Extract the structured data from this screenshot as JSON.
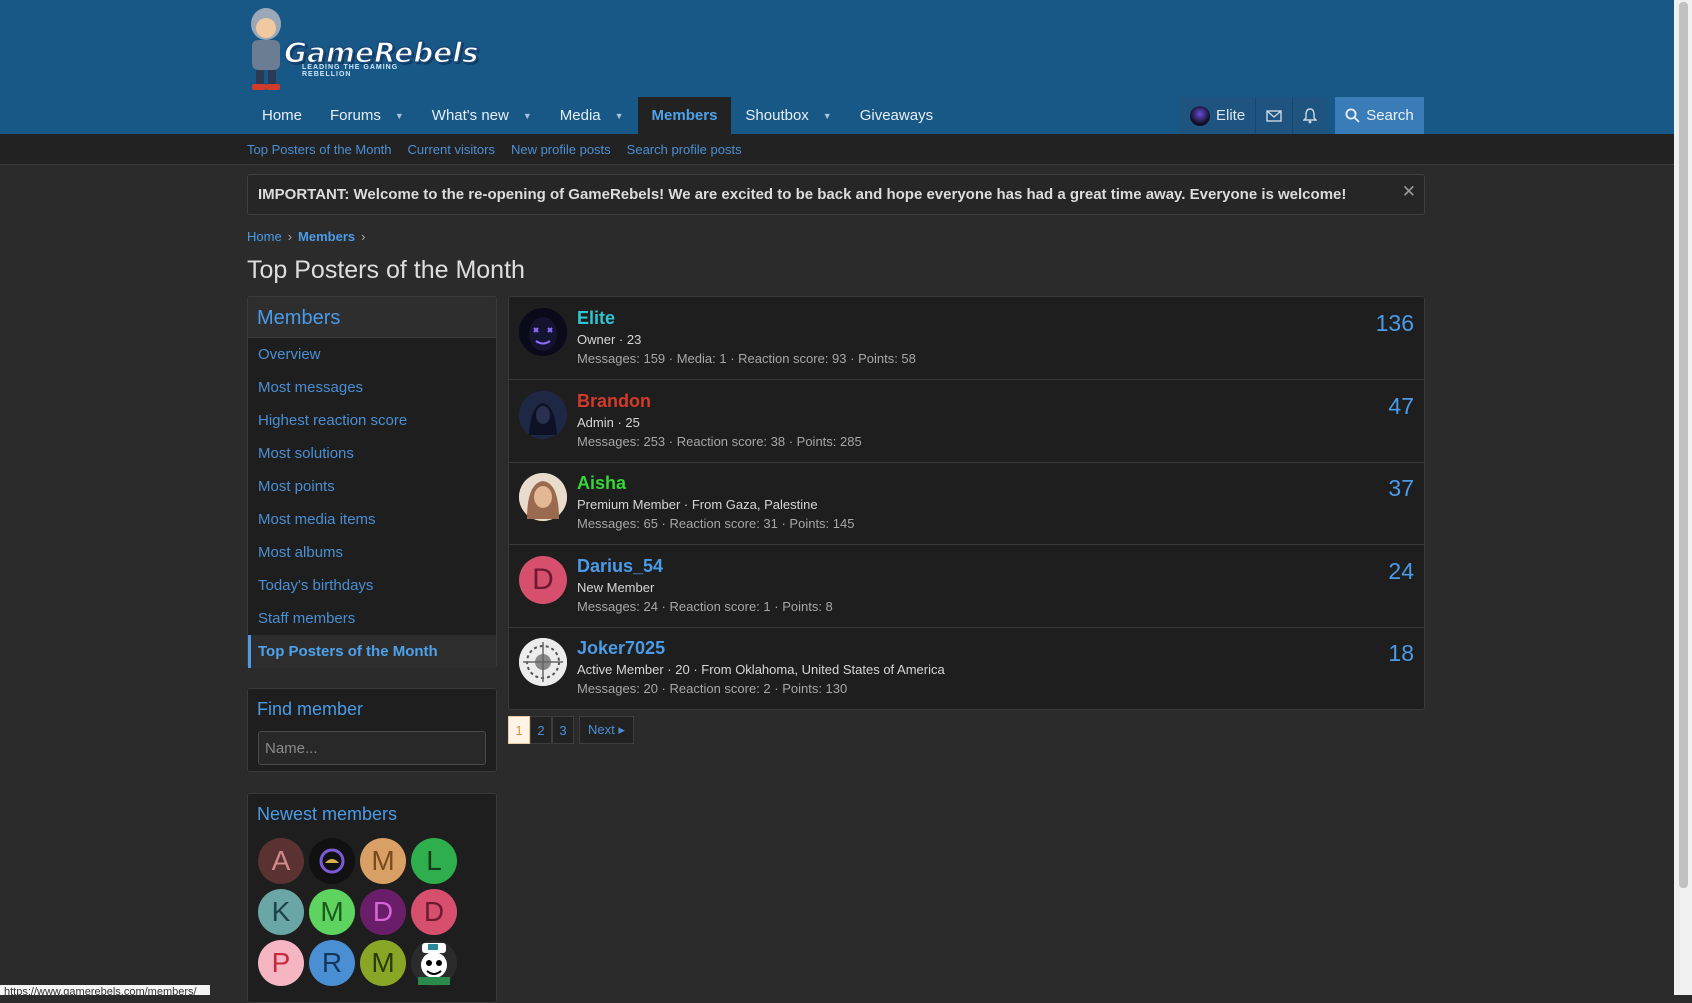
{
  "brand": {
    "name": "GameRebels",
    "tagline": "LEADING THE GAMING REBELLION"
  },
  "nav": {
    "items": [
      {
        "label": "Home",
        "dropdown": false
      },
      {
        "label": "Forums",
        "dropdown": true
      },
      {
        "label": "What's new",
        "dropdown": true
      },
      {
        "label": "Media",
        "dropdown": true
      },
      {
        "label": "Members",
        "dropdown": false,
        "active": true
      },
      {
        "label": "Shoutbox",
        "dropdown": true
      },
      {
        "label": "Giveaways",
        "dropdown": false
      }
    ],
    "user": "Elite",
    "search": "Search"
  },
  "subnav": [
    "Top Posters of the Month",
    "Current visitors",
    "New profile posts",
    "Search profile posts"
  ],
  "notice": "IMPORTANT: Welcome to the re-opening of GameRebels! We are excited to be back and hope everyone has had a great time away. Everyone is welcome!",
  "breadcrumb": [
    "Home",
    "Members"
  ],
  "title": "Top Posters of the Month",
  "sidebar": {
    "heading": "Members",
    "items": [
      "Overview",
      "Most messages",
      "Highest reaction score",
      "Most solutions",
      "Most points",
      "Most media items",
      "Most albums",
      "Today's birthdays",
      "Staff members",
      "Top Posters of the Month"
    ],
    "selected_index": 9,
    "find": {
      "heading": "Find member",
      "placeholder": "Name..."
    },
    "newest": {
      "heading": "Newest members",
      "members": [
        {
          "letter": "A",
          "bg": "#5a3232",
          "fg": "#d08a8a"
        },
        {
          "letter": "",
          "bg": "#111111",
          "fg": "#7a5ad8"
        },
        {
          "letter": "M",
          "bg": "#d9a066",
          "fg": "#7a4a1e"
        },
        {
          "letter": "L",
          "bg": "#2fae4e",
          "fg": "#0d3d1a"
        },
        {
          "letter": "K",
          "bg": "#6aa6a6",
          "fg": "#1d4444"
        },
        {
          "letter": "M",
          "bg": "#5fd35f",
          "fg": "#1d5a1d"
        },
        {
          "letter": "D",
          "bg": "#6a1e6a",
          "fg": "#d865d8"
        },
        {
          "letter": "D",
          "bg": "#d6506e",
          "fg": "#6e1a2e"
        },
        {
          "letter": "P",
          "bg": "#f5b5c2",
          "fg": "#c52a3c"
        },
        {
          "letter": "R",
          "bg": "#4a8fd4",
          "fg": "#13385c"
        },
        {
          "letter": "M",
          "bg": "#8aa626",
          "fg": "#2e3a0a"
        },
        {
          "letter": "",
          "bg": "#2b2b2b",
          "fg": "#ffffff"
        }
      ]
    }
  },
  "members": [
    {
      "name": "Elite",
      "name_color": "#2fc4ce",
      "role": "Owner · 23",
      "stats": "Messages: 159 · Media: 1 · Reaction score: 93 · Points: 58",
      "count": "136",
      "avatar": {
        "letter": "",
        "bg": "#0c0c1e",
        "fg": "#7a5ad8"
      }
    },
    {
      "name": "Brandon",
      "name_color": "#d23a2a",
      "role": "Admin · 25",
      "stats": "Messages: 253 · Reaction score: 38 · Points: 285",
      "count": "47",
      "avatar": {
        "letter": "",
        "bg": "#1e2a4a",
        "fg": "#9ab"
      }
    },
    {
      "name": "Aisha",
      "name_color": "#35d635",
      "role": "Premium Member · From Gaza, Palestine",
      "stats": "Messages: 65 · Reaction score: 31 · Points: 145",
      "count": "37",
      "avatar": {
        "letter": "",
        "bg": "#c8a58a",
        "fg": "#5a3a2a"
      }
    },
    {
      "name": "Darius_54",
      "name_color": "#4a9be8",
      "role": "New Member",
      "stats": "Messages: 24 · Reaction score: 1 · Points: 8",
      "count": "24",
      "avatar": {
        "letter": "D",
        "bg": "#d6506e",
        "fg": "#6e1a2e"
      }
    },
    {
      "name": "Joker7025",
      "name_color": "#4a9be8",
      "role": "Active Member · 20 · From Oklahoma, United States of America",
      "stats": "Messages: 20 · Reaction score: 2 · Points: 130",
      "count": "18",
      "avatar": {
        "letter": "",
        "bg": "#e6e6e6",
        "fg": "#333333"
      }
    }
  ],
  "pagination": {
    "pages": [
      "1",
      "2",
      "3"
    ],
    "current": "1",
    "next": "Next ▸"
  },
  "statusbar": "https://www.gamerebels.com/members/"
}
